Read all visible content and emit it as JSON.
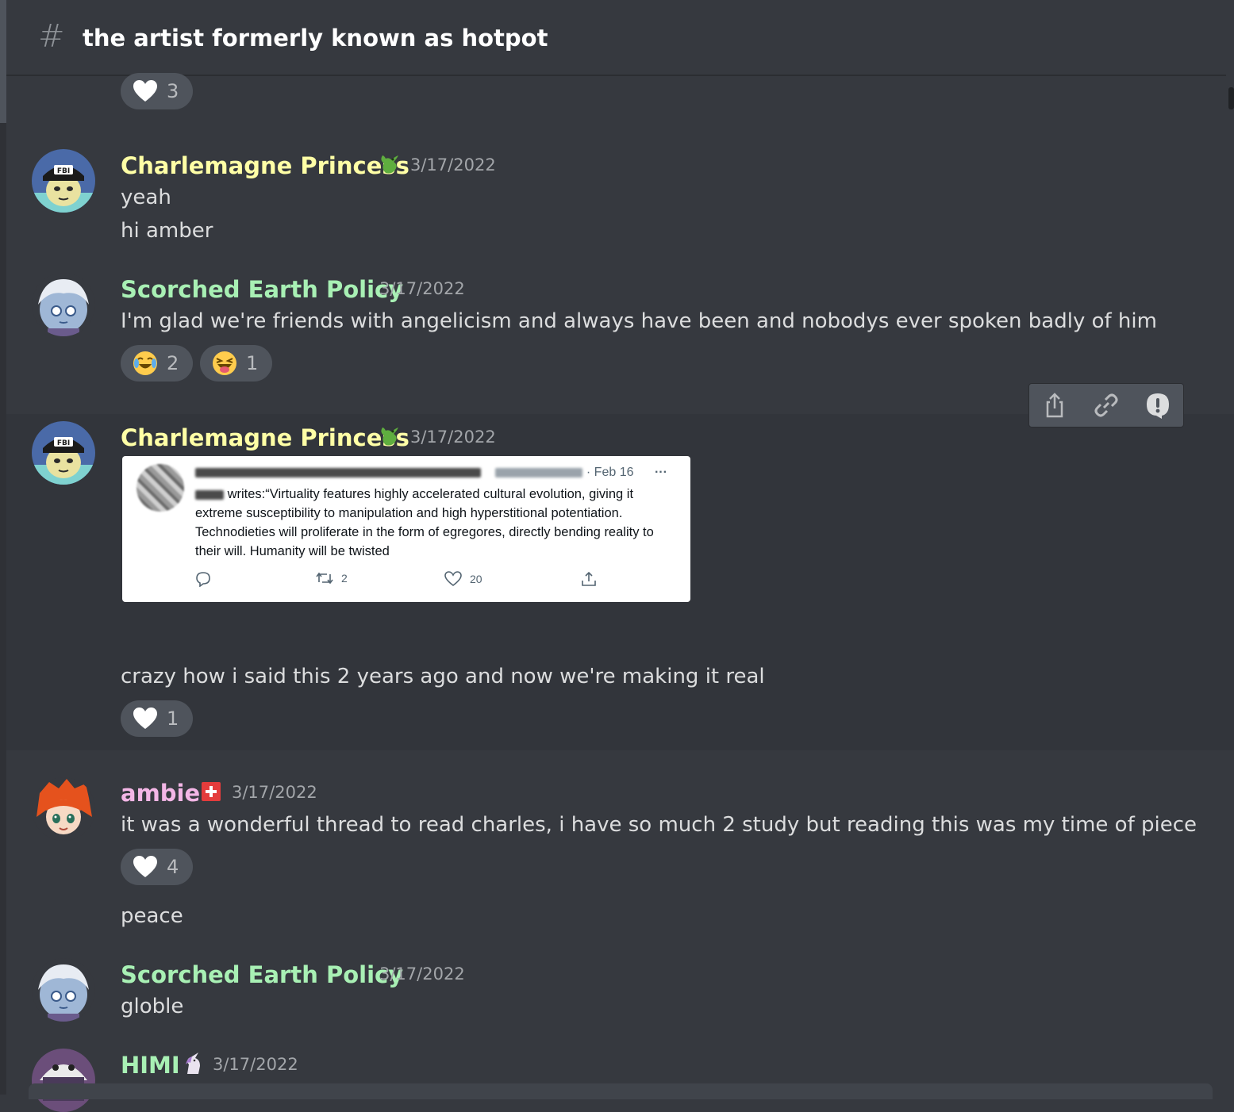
{
  "channel": {
    "name": "the artist formerly known as hotpot"
  },
  "colors": {
    "background": "#36393f",
    "charlemagne": "#ffffa6",
    "scorched": "#a8f0b4",
    "ambie": "#f3b6e6",
    "himi": "#a8f0b4",
    "reaction_bg": "#4f545c"
  },
  "top_reaction": {
    "emoji": "heart",
    "count": "3"
  },
  "messages": [
    {
      "author": "Charlemagne Princess",
      "badge": "dragon-icon",
      "timestamp": "3/17/2022",
      "lines": [
        "yeah",
        "hi amber"
      ]
    },
    {
      "author": "Scorched Earth Policy",
      "timestamp": "3/17/2022",
      "lines": [
        "I'm glad we're friends with angelicism and always have been and nobodys ever spoken badly of him"
      ],
      "reactions": [
        {
          "emoji": "joy",
          "count": "2"
        },
        {
          "emoji": "laughing-tongue",
          "count": "1"
        }
      ]
    },
    {
      "author": "Charlemagne Princess",
      "badge": "dragon-icon",
      "timestamp": "3/17/2022",
      "tweet": {
        "date": "· Feb 16",
        "more": "···",
        "writes_label": "writes:",
        "text": "“Virtuality features highly accelerated cultural evolution, giving it extreme susceptibility to manipulation and high hyperstitional potentiation. Technodieties will proliferate in the form of egregores, directly bending reality to their will. Humanity will be twisted",
        "retweets": "2",
        "likes": "20"
      },
      "lines": [
        "crazy how i said this 2 years ago and now we're making it real"
      ],
      "reactions": [
        {
          "emoji": "heart",
          "count": "1"
        }
      ]
    },
    {
      "author": "ambie",
      "badge": "swiss-flag-icon",
      "timestamp": "3/17/2022",
      "lines": [
        "it was a wonderful thread to read charles, i have so much 2 study but reading this was my time of piece"
      ],
      "reactions": [
        {
          "emoji": "heart",
          "count": "4"
        }
      ],
      "followup": "peace"
    },
    {
      "author": "Scorched Earth Policy",
      "timestamp": "3/17/2022",
      "lines": [
        "globle"
      ]
    },
    {
      "author": "HIMI",
      "badge": "unicorn-icon",
      "timestamp": "3/17/2022"
    }
  ],
  "toolbar": [
    "share-icon",
    "link-icon",
    "report-icon"
  ]
}
